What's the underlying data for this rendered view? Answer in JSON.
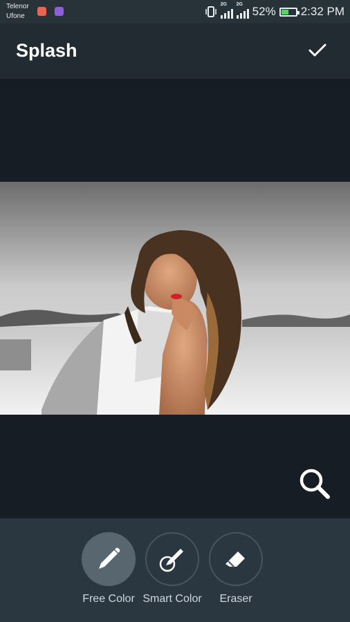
{
  "statusbar": {
    "carrier1": "Telenor",
    "carrier2": "Ufone",
    "network1": "2G",
    "network2": "2G",
    "battery": "52%",
    "battery_level": 0.52,
    "time": "2:32 PM"
  },
  "appbar": {
    "title": "Splash",
    "confirm_icon": "checkmark-icon"
  },
  "canvas": {
    "zoom_icon": "magnifier-icon"
  },
  "tools": [
    {
      "label": "Free Color",
      "icon": "brush-icon",
      "active": true
    },
    {
      "label": "Smart Color",
      "icon": "smart-brush-icon",
      "active": false
    },
    {
      "label": "Eraser",
      "icon": "eraser-icon",
      "active": false
    }
  ],
  "colors": {
    "statusbar": "#283239",
    "appbar": "#222b32",
    "canvas": "#171d24",
    "toolbar": "#2b3740",
    "active_tool": "#58676f"
  }
}
